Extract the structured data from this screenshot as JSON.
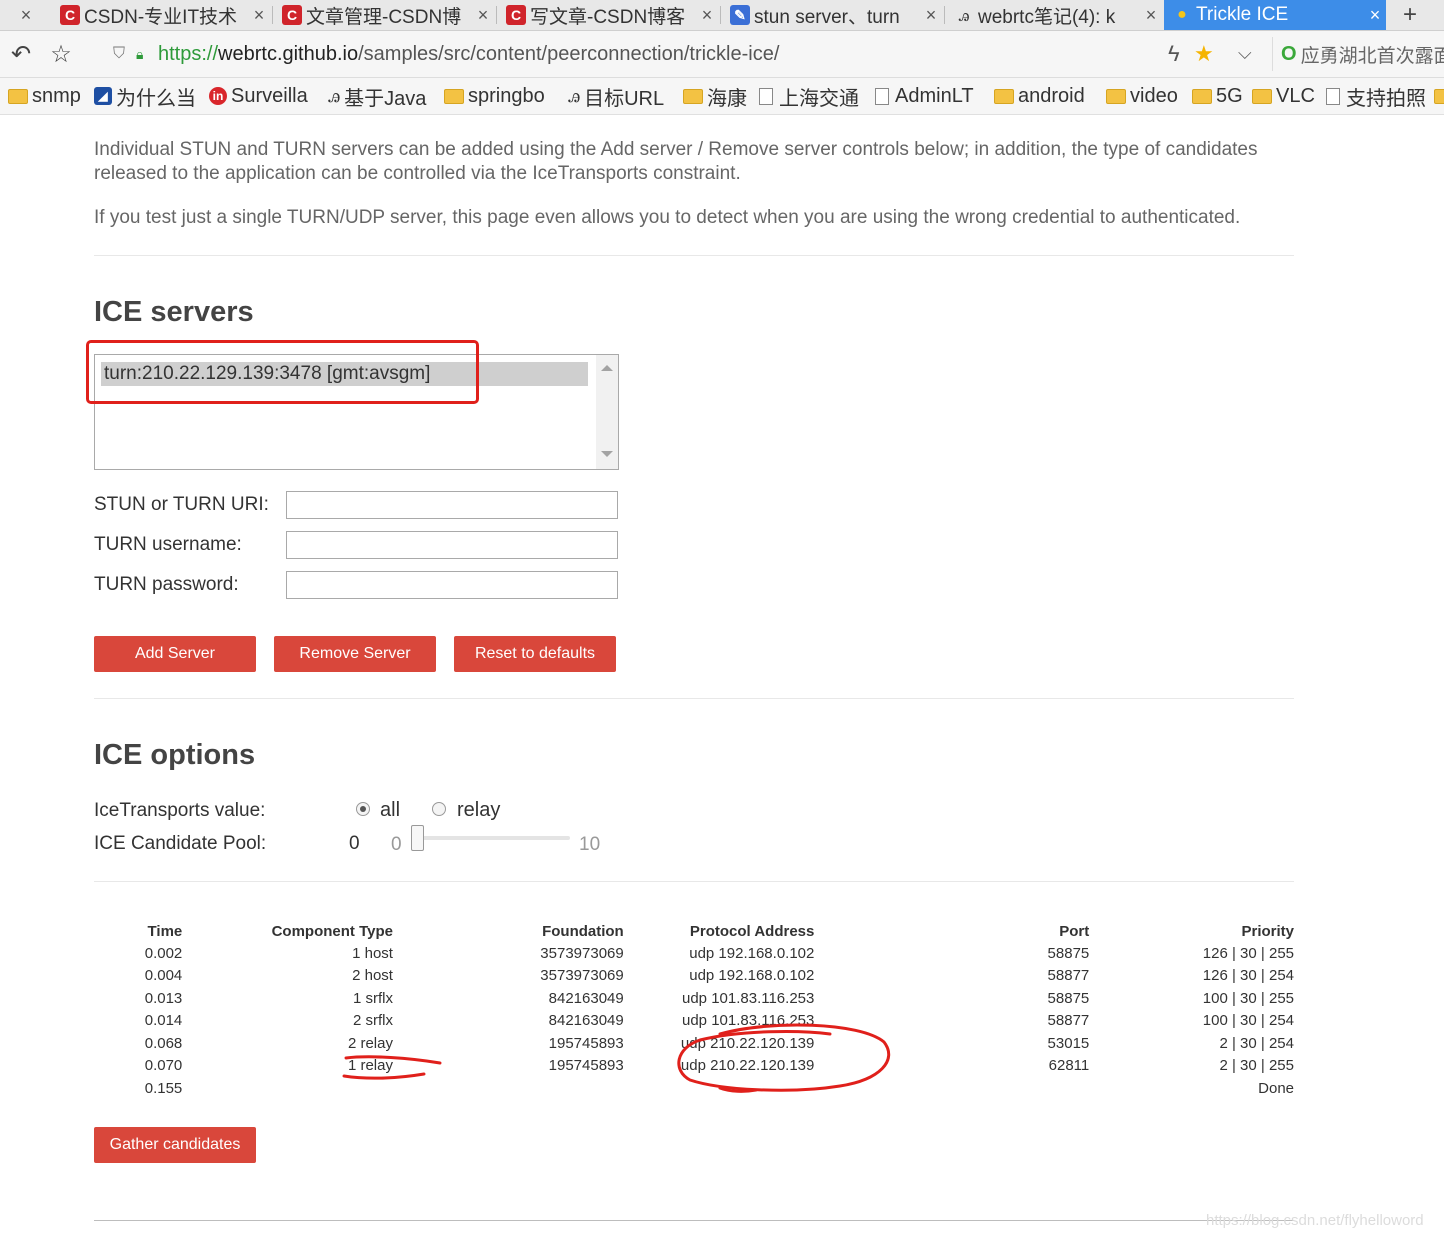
{
  "browser": {
    "tabs": [
      {
        "label": "CSDN-专业IT技术",
        "icon": "csdn-icon"
      },
      {
        "label": "文章管理-CSDN博",
        "icon": "csdn-icon"
      },
      {
        "label": "写文章-CSDN博客",
        "icon": "csdn-icon"
      },
      {
        "label": "stun server、turn",
        "icon": "edit-icon"
      },
      {
        "label": "webrtc笔记(4): k",
        "icon": "wolf-icon"
      },
      {
        "label": "Trickle ICE",
        "icon": "chrome-icon",
        "active": true
      }
    ],
    "close_glyph": "×",
    "newtab_glyph": "+",
    "url": {
      "scheme": "https://",
      "host": "webrtc.github.io",
      "path": "/samples/src/content/peerconnection/trickle-ice/"
    },
    "search_hint": "应勇湖北首次露面",
    "bookmarks": [
      {
        "label": "snmp",
        "icon": "folder-icon"
      },
      {
        "label": "为什么当",
        "icon": "site-icon"
      },
      {
        "label": "Surveilla",
        "icon": "site-icon"
      },
      {
        "label": "基于Java",
        "icon": "wolf-icon"
      },
      {
        "label": "springbo",
        "icon": "folder-icon"
      },
      {
        "label": "目标URL",
        "icon": "wolf-icon"
      },
      {
        "label": "海康",
        "icon": "folder-icon"
      },
      {
        "label": "上海交通",
        "icon": "page-icon"
      },
      {
        "label": "AdminLT",
        "icon": "page-icon"
      },
      {
        "label": "android",
        "icon": "folder-icon"
      },
      {
        "label": "video",
        "icon": "folder-icon"
      },
      {
        "label": "5G",
        "icon": "folder-icon"
      },
      {
        "label": "VLC",
        "icon": "folder-icon"
      },
      {
        "label": "支持拍照",
        "icon": "page-icon"
      }
    ]
  },
  "intro": {
    "p1": "Individual STUN and TURN servers can be added using the Add server / Remove server controls below; in addition, the type of candidates released to the application can be controlled via the IceTransports constraint.",
    "p2": "If you test just a single TURN/UDP server, this page even allows you to detect when you are using the wrong credential to authenticated."
  },
  "ice_servers": {
    "heading": "ICE servers",
    "list": [
      "turn:210.22.129.139:3478 [gmt:avsgm]"
    ],
    "fields": {
      "uri_label": "STUN or TURN URI:",
      "uri_value": "",
      "username_label": "TURN username:",
      "username_value": "",
      "password_label": "TURN password:",
      "password_value": ""
    },
    "buttons": {
      "add": "Add Server",
      "remove": "Remove Server",
      "reset": "Reset to defaults"
    }
  },
  "ice_options": {
    "heading": "ICE options",
    "transports_label": "IceTransports value:",
    "transport_all": "all",
    "transport_relay": "relay",
    "selected": "all",
    "pool_label": "ICE Candidate Pool:",
    "pool_value": "0",
    "pool_min": "0",
    "pool_max": "10"
  },
  "candidates": {
    "headers": {
      "time": "Time",
      "component": "Component Type",
      "foundation": "Foundation",
      "protocol": "Protocol Address",
      "port": "Port",
      "priority": "Priority"
    },
    "rows": [
      {
        "time": "0.002",
        "component": "1 host",
        "foundation": "3573973069",
        "protocol": "udp 192.168.0.102",
        "port": "58875",
        "priority": "126 | 30 | 255"
      },
      {
        "time": "0.004",
        "component": "2 host",
        "foundation": "3573973069",
        "protocol": "udp 192.168.0.102",
        "port": "58877",
        "priority": "126 | 30 | 254"
      },
      {
        "time": "0.013",
        "component": "1 srflx",
        "foundation": "842163049",
        "protocol": "udp 101.83.116.253",
        "port": "58875",
        "priority": "100 | 30 | 255"
      },
      {
        "time": "0.014",
        "component": "2 srflx",
        "foundation": "842163049",
        "protocol": "udp 101.83.116.253",
        "port": "58877",
        "priority": "100 | 30 | 254"
      },
      {
        "time": "0.068",
        "component": "2 relay",
        "foundation": "195745893",
        "protocol": "udp 210.22.120.139",
        "port": "53015",
        "priority": "2 | 30 | 254"
      },
      {
        "time": "0.070",
        "component": "1 relay",
        "foundation": "195745893",
        "protocol": "udp 210.22.120.139",
        "port": "62811",
        "priority": "2 | 30 | 255"
      },
      {
        "time": "0.155",
        "component": "",
        "foundation": "",
        "protocol": "",
        "port": "",
        "priority": "Done"
      }
    ],
    "gather_button": "Gather candidates"
  },
  "watermark": "https://blog.csdn.net/flyhelloword",
  "colors": {
    "accent": "#d9473b",
    "annotation": "#e0201b",
    "active_tab": "#3d8de8"
  }
}
